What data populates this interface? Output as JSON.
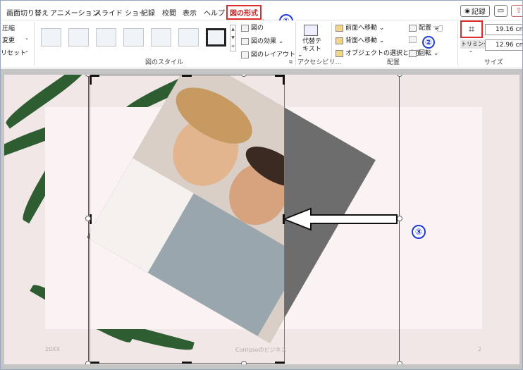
{
  "tabs": [
    "画面切り替え",
    "アニメーション",
    "スライド ショー",
    "記録",
    "校閲",
    "表示",
    "ヘルプ",
    "図の形式"
  ],
  "header_buttons": {
    "record_label": "記録"
  },
  "ribbon": {
    "adjust_items": [
      "圧縮",
      "変更",
      "リセット"
    ],
    "picture_effects": [
      "図の",
      "図の効果",
      "図のレイアウト"
    ],
    "alt_text_label": "代替テ\nキスト",
    "accessibility_label": "アクセシビリ…",
    "arrange_items": [
      "前面へ移動",
      "背面へ移動",
      "オブジェクトの選択と表示"
    ],
    "arrange_right": [
      "配置",
      "回転"
    ],
    "trim_label": "トリミング",
    "height": "19.16 cm",
    "width": "12.96 cm",
    "groups": [
      "図のスタイル",
      "配置",
      "サイズ"
    ]
  },
  "annotations": [
    "①",
    "②",
    "③"
  ],
  "slide": {
    "footer_left": "20XX",
    "footer_center": "Contosoのビジネス",
    "page_number": "2"
  },
  "colors": {
    "active_tab_border": "#e02b2b",
    "annotation_blue": "#1d3bdb",
    "dark_leaf": "#2f5d32"
  }
}
